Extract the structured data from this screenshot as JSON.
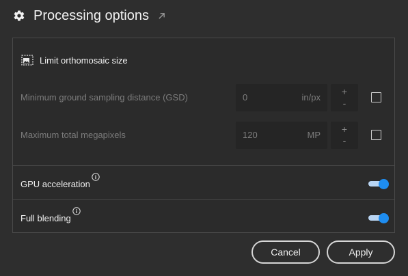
{
  "dialog": {
    "title": "Processing options",
    "title_icon": "gear-icon",
    "external_icon": "arrow-up-right-icon"
  },
  "limit_section": {
    "title": "Limit orthomosaic size",
    "icon": "image-frame-icon",
    "gsd": {
      "label": "Minimum ground sampling distance (GSD)",
      "value": "0",
      "unit": "in/px",
      "plus": "+",
      "minus": "-",
      "checked": false
    },
    "megapixels": {
      "label": "Maximum total megapixels",
      "value": "120",
      "unit": "MP",
      "plus": "+",
      "minus": "-",
      "checked": false
    }
  },
  "gpu": {
    "label": "GPU acceleration",
    "enabled": true,
    "info_icon": "info-icon"
  },
  "blending": {
    "label": "Full blending",
    "enabled": true,
    "info_icon": "info-icon"
  },
  "buttons": {
    "cancel": "Cancel",
    "apply": "Apply"
  },
  "colors": {
    "accent": "#1e8df0",
    "track": "#b9d5f3",
    "background": "#2e2e2e"
  }
}
